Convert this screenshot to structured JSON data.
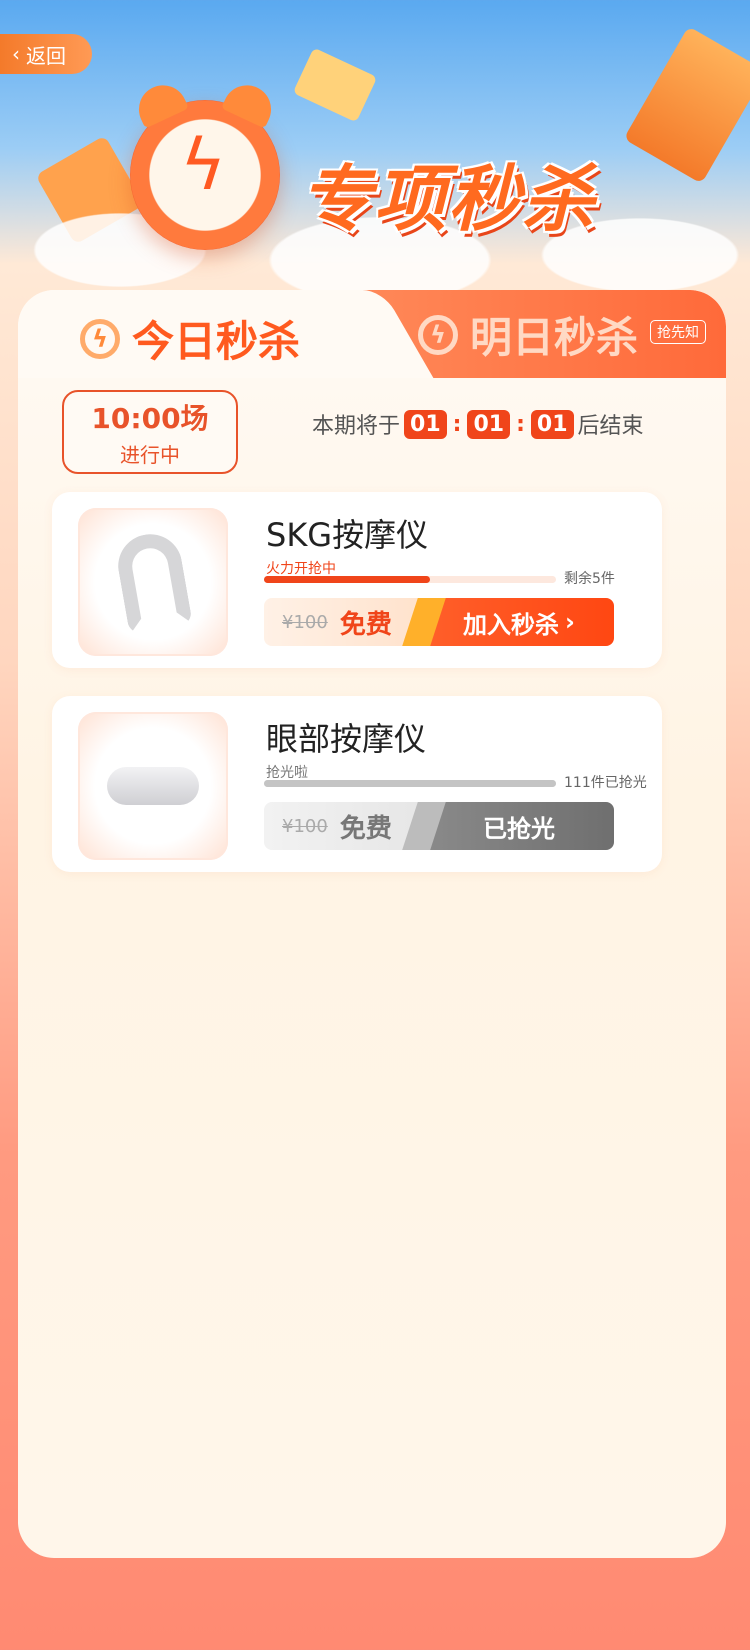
{
  "header": {
    "back_label": "返回",
    "title": "专项秒杀"
  },
  "tabs": [
    {
      "label": "今日秒杀",
      "active": true
    },
    {
      "label": "明日秒杀",
      "active": false,
      "badge": "抢先知"
    }
  ],
  "session": {
    "time": "10:00场",
    "status": "进行中"
  },
  "countdown": {
    "prefix": "本期将于",
    "hours": "01",
    "minutes": "01",
    "seconds": "01",
    "suffix": "后结束"
  },
  "products": [
    {
      "name": "SKG按摩仪",
      "progress_label": "火力开抢中",
      "progress": 0.57,
      "stock_text": "剩余5件",
      "original_price": "¥100",
      "price": "免费",
      "action_label": "加入秒杀",
      "action_icon": "chevron-right-icon",
      "status": "active"
    },
    {
      "name": "眼部按摩仪",
      "progress_label": "抢光啦",
      "progress": 1.0,
      "stock_text": "111件已抢光",
      "original_price": "¥100",
      "price": "免费",
      "action_label": "已抢光",
      "status": "sold-out"
    }
  ],
  "colors": {
    "accent": "#f0451a",
    "accent_light": "#ff8a3a",
    "disabled": "#777777"
  }
}
